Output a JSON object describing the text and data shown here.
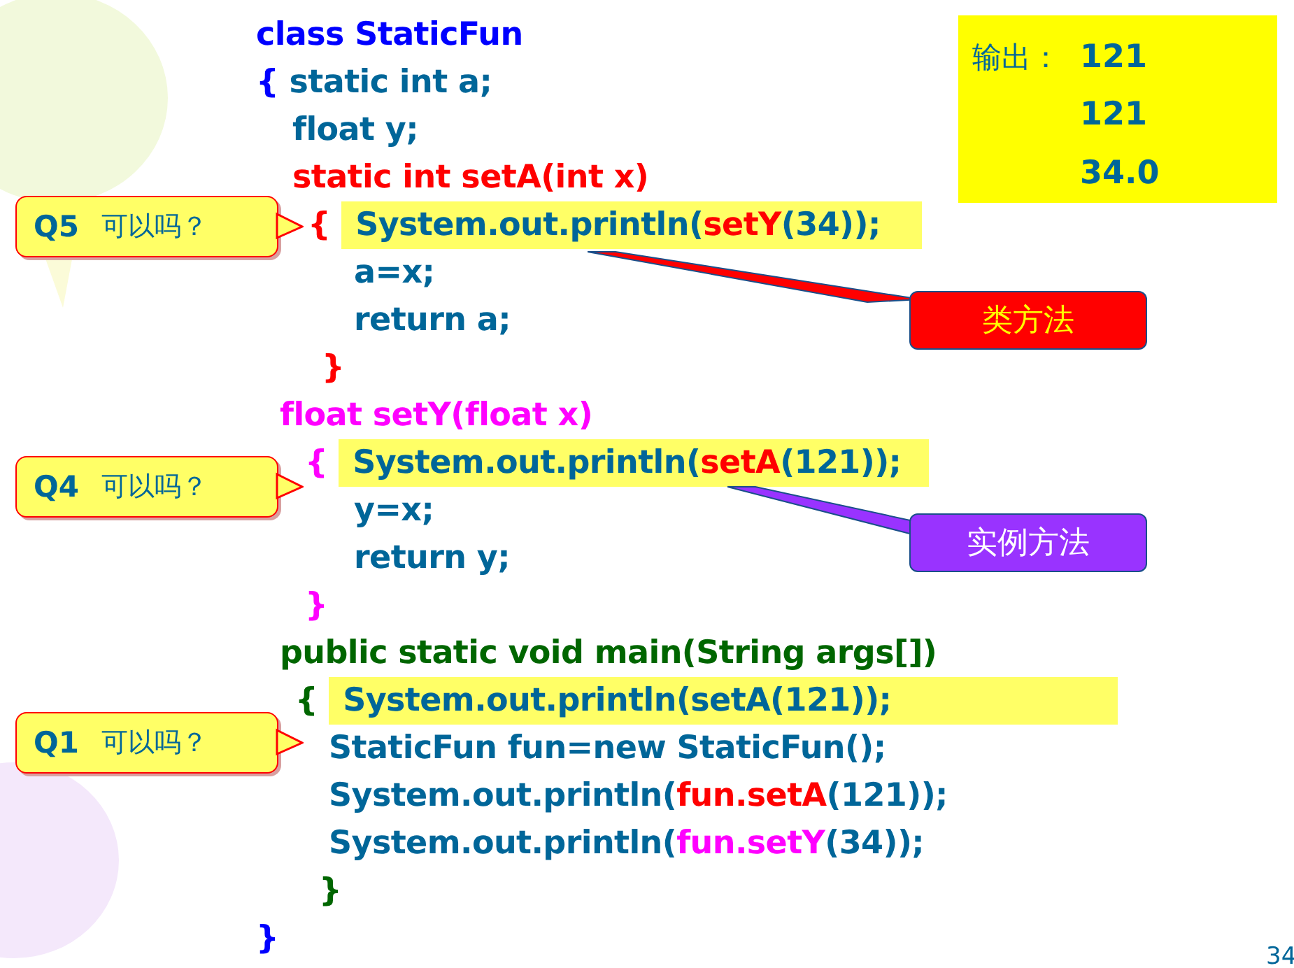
{
  "code_lines": [
    {
      "highlighted": false,
      "segments": [
        {
          "text": "class StaticFun",
          "color": "#0000ff"
        }
      ]
    },
    {
      "highlighted": false,
      "segments": [
        {
          "text": "{ ",
          "color": "#0000ff"
        },
        {
          "text": "static int a;",
          "color": "#006699"
        }
      ]
    },
    {
      "highlighted": false,
      "segments": [
        {
          "text": "float y;",
          "color": "#006699"
        }
      ]
    },
    {
      "highlighted": false,
      "segments": [
        {
          "text": "static int setA(int x)",
          "color": "#ff0000"
        }
      ]
    },
    {
      "highlighted": true,
      "brace": {
        "text": "{",
        "color": "#ff0000"
      },
      "segments": [
        {
          "text": "System.out.println(",
          "color": "#006699"
        },
        {
          "text": "setY",
          "color": "#ff0000"
        },
        {
          "text": "(34));",
          "color": "#006699"
        }
      ]
    },
    {
      "highlighted": false,
      "segments": [
        {
          "text": "a=x;",
          "color": "#006699"
        }
      ]
    },
    {
      "highlighted": false,
      "segments": [
        {
          "text": "return a;",
          "color": "#006699"
        }
      ]
    },
    {
      "highlighted": false,
      "segments": [
        {
          "text": "}",
          "color": "#ff0000"
        }
      ]
    },
    {
      "highlighted": false,
      "segments": [
        {
          "text": "float setY(float x)",
          "color": "#ff00ff"
        }
      ]
    },
    {
      "highlighted": true,
      "brace": {
        "text": "{",
        "color": "#ff00ff"
      },
      "segments": [
        {
          "text": "System.out.println(",
          "color": "#006699"
        },
        {
          "text": "setA",
          "color": "#ff0000"
        },
        {
          "text": "(121));",
          "color": "#006699"
        }
      ]
    },
    {
      "highlighted": false,
      "segments": [
        {
          "text": "y=x;",
          "color": "#006699"
        }
      ]
    },
    {
      "highlighted": false,
      "segments": [
        {
          "text": "return y;",
          "color": "#006699"
        }
      ]
    },
    {
      "highlighted": false,
      "segments": [
        {
          "text": "}",
          "color": "#ff00ff"
        }
      ]
    },
    {
      "highlighted": false,
      "segments": [
        {
          "text": "public static void main(String args[])",
          "color": "#006600"
        }
      ]
    },
    {
      "highlighted": true,
      "brace": {
        "text": "{",
        "color": "#006600"
      },
      "segments": [
        {
          "text": "System.out.println(setA(121));",
          "color": "#006699"
        }
      ]
    },
    {
      "highlighted": false,
      "segments": [
        {
          "text": "StaticFun fun=new StaticFun();",
          "color": "#006699"
        }
      ]
    },
    {
      "highlighted": false,
      "segments": [
        {
          "text": "System.out.println(",
          "color": "#006699"
        },
        {
          "text": "fun.setA",
          "color": "#ff0000"
        },
        {
          "text": "(121));",
          "color": "#006699"
        }
      ]
    },
    {
      "highlighted": false,
      "segments": [
        {
          "text": "System.out.println(",
          "color": "#006699"
        },
        {
          "text": "fun.setY",
          "color": "#ff00ff"
        },
        {
          "text": "(34));",
          "color": "#006699"
        }
      ]
    },
    {
      "highlighted": false,
      "segments": [
        {
          "text": "}",
          "color": "#006600"
        }
      ]
    },
    {
      "highlighted": false,
      "segments": [
        {
          "text": "}",
          "color": "#0000ff"
        }
      ]
    }
  ],
  "callouts": [
    {
      "label": "Q5",
      "question": "可以吗？"
    },
    {
      "label": "Q4",
      "question": "可以吗？"
    },
    {
      "label": "Q1",
      "question": "可以吗？"
    }
  ],
  "tags": [
    {
      "text": "类方法",
      "color": "#ff0000"
    },
    {
      "text": "实例方法",
      "color": "#9933ff"
    }
  ],
  "output": {
    "label": "输出：",
    "values": [
      "121",
      "121",
      "34.0"
    ]
  },
  "page_number": "34"
}
